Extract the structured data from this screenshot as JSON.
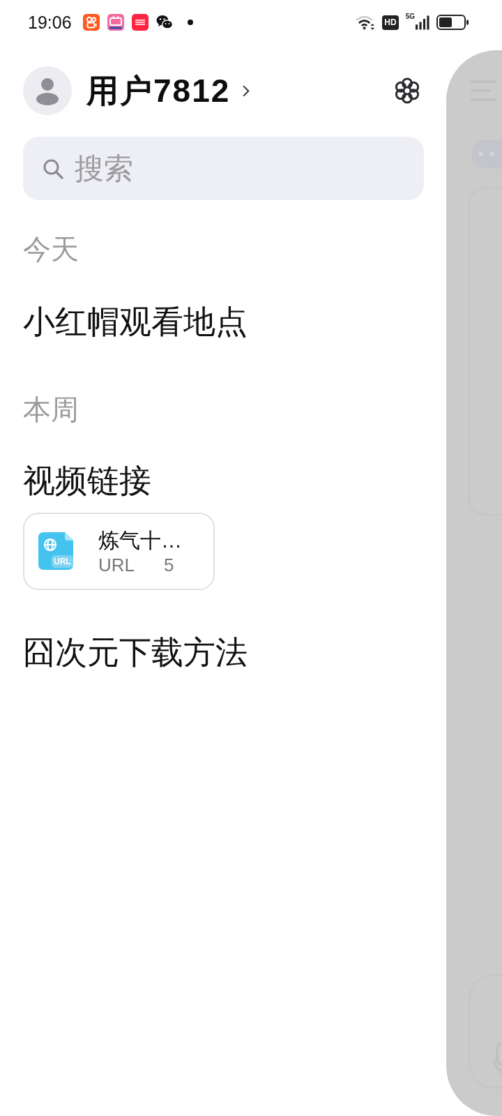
{
  "status_bar": {
    "time": "19:06",
    "hd_badge": "HD",
    "network_type": "5G"
  },
  "profile": {
    "username": "用户7812"
  },
  "search": {
    "placeholder": "搜索"
  },
  "history": [
    {
      "heading": "今天",
      "items": [
        {
          "kind": "chat",
          "title": "小红帽观看地点"
        }
      ]
    },
    {
      "heading": "本周",
      "items": [
        {
          "kind": "chat",
          "title": "视频链接"
        },
        {
          "kind": "file",
          "badge": "URL",
          "title": "炼气十…",
          "file_type": "URL",
          "size": "5"
        },
        {
          "kind": "chat",
          "title": "囧次元下载方法"
        }
      ]
    }
  ]
}
